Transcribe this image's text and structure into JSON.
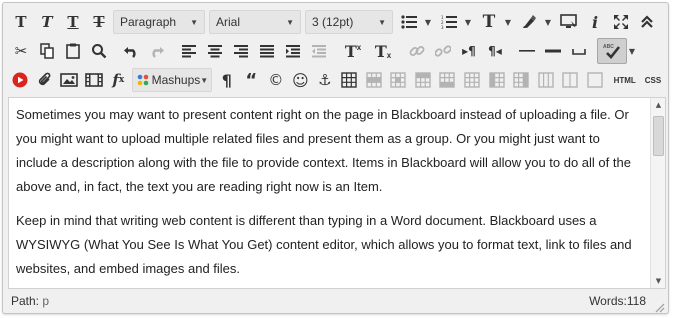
{
  "toolbar": {
    "format_select": "Paragraph",
    "font_select": "Arial",
    "size_select": "3 (12pt)",
    "mashups_select": "Mashups",
    "html_label": "HTML",
    "css_label": "CSS"
  },
  "content": {
    "paragraphs": [
      "Sometimes you may want to present content right on the page in Blackboard instead of uploading a file.  Or you might want to upload multiple related files and present them as a group.  Or you might just want to include a description along with the file to provide context.  Items in Blackboard will allow you to do all of the above and, in fact, the text you are reading right now is an Item.",
      "Keep in mind that writing web content is different than typing in a Word document.  Blackboard uses a WYSIWYG (What You See Is What You Get) content editor, which allows you to format text, link to files and websites, and embed images and files."
    ]
  },
  "status": {
    "path_label": "Path:",
    "path_value": "p",
    "words_label": "Words:",
    "words_value": "118"
  },
  "colors": {
    "youtube_red": "#d9251d",
    "mashup_dots": [
      "#3a7bd5",
      "#e94b3c",
      "#f2b600",
      "#34a853"
    ]
  }
}
